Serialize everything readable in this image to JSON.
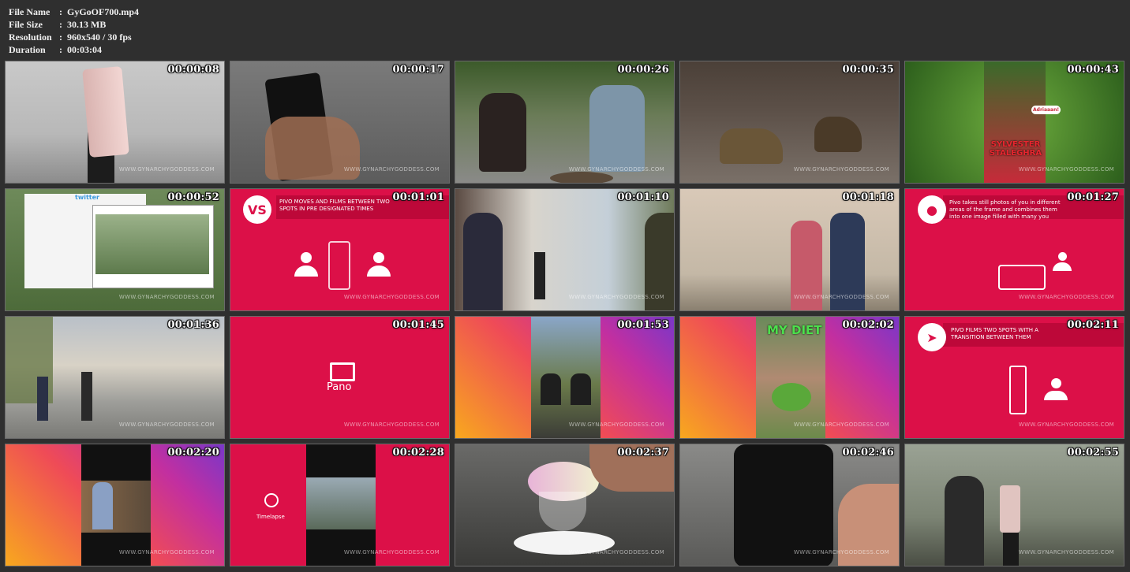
{
  "file_info": {
    "name_label": "File Name",
    "name_value": "GyGoOF700.mp4",
    "size_label": "File Size",
    "size_value": "30.13 MB",
    "resolution_label": "Resolution",
    "resolution_value": "960x540 / 30 fps",
    "duration_label": "Duration",
    "duration_value": "00:03:04",
    "separator": ":"
  },
  "watermark": "WWW.GYNARCHYGODDESS.COM",
  "thumbnails": [
    {
      "time": "00:00:08"
    },
    {
      "time": "00:00:17"
    },
    {
      "time": "00:00:26"
    },
    {
      "time": "00:00:35"
    },
    {
      "time": "00:00:43",
      "caption_top": "Adriaaan!",
      "caption_bottom": "SYLVESTER STALEGHRA"
    },
    {
      "time": "00:00:52",
      "caption": "twitter"
    },
    {
      "time": "00:01:01",
      "logo": "VS",
      "caption": "PIVO MOVES AND FILMS BETWEEN TWO SPOTS IN PRE DESIGNATED TIMES"
    },
    {
      "time": "00:01:10"
    },
    {
      "time": "00:01:18"
    },
    {
      "time": "00:01:27",
      "caption": "Pivo takes still photos of you in different areas of the frame and combines them into one image filled with many you"
    },
    {
      "time": "00:01:36"
    },
    {
      "time": "00:01:45",
      "caption": "Pano"
    },
    {
      "time": "00:01:53"
    },
    {
      "time": "00:02:02",
      "caption": "MY DIET"
    },
    {
      "time": "00:02:11",
      "caption": "PIVO FILMS TWO SPOTS WITH A TRANSITION BETWEEN THEM"
    },
    {
      "time": "00:02:20"
    },
    {
      "time": "00:02:28",
      "caption": "Timelapse"
    },
    {
      "time": "00:02:37"
    },
    {
      "time": "00:02:46"
    },
    {
      "time": "00:02:55"
    }
  ]
}
